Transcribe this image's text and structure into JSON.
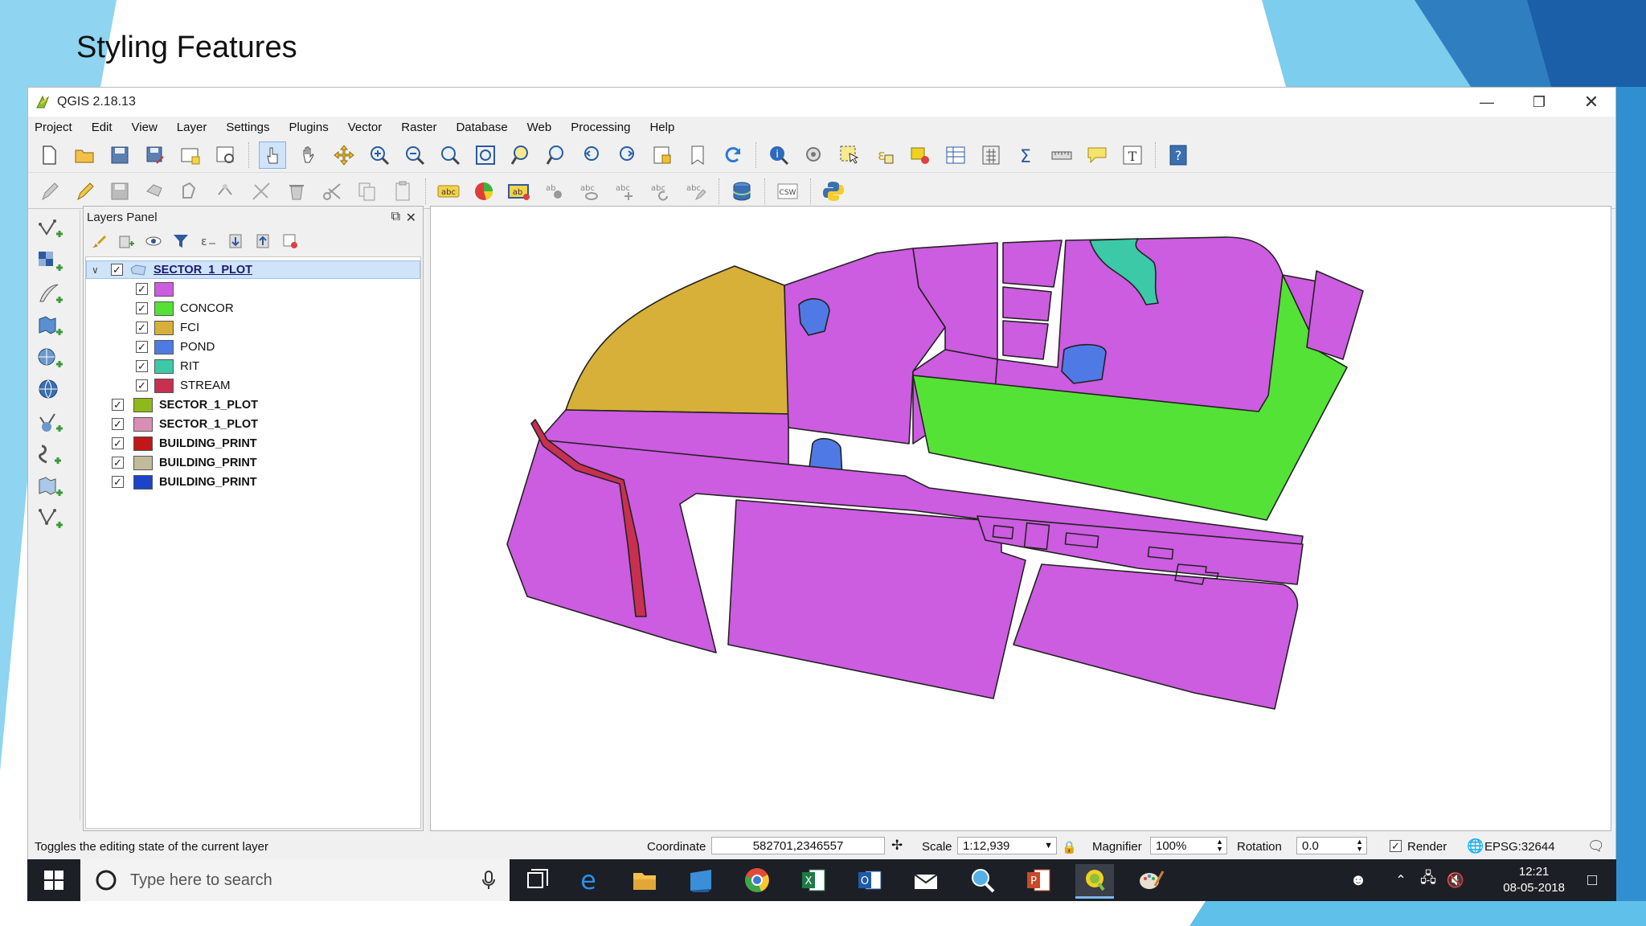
{
  "slide": {
    "title": "Styling Features"
  },
  "window": {
    "title": "QGIS 2.18.13"
  },
  "menu": [
    "Project",
    "Edit",
    "View",
    "Layer",
    "Settings",
    "Plugins",
    "Vector",
    "Raster",
    "Database",
    "Web",
    "Processing",
    "Help"
  ],
  "toolbar_icons": {
    "main": [
      "new-project-icon",
      "open-project-icon",
      "save-project-icon",
      "save-as-icon",
      "new-print-composer-icon",
      "composer-manager-icon",
      "touch-zoom-icon",
      "pan-icon",
      "pan-to-selection-icon",
      "zoom-in-icon",
      "zoom-out-icon",
      "zoom-native-icon",
      "zoom-full-icon",
      "zoom-to-selection-icon",
      "zoom-to-layer-icon",
      "zoom-last-icon",
      "zoom-next-icon",
      "new-map-view-icon",
      "new-bookmark-icon",
      "refresh-icon",
      "identify-icon",
      "action-icon",
      "select-feature-icon",
      "select-by-value-icon",
      "deselect-icon",
      "attribute-table-icon",
      "field-calculator-icon",
      "statistics-icon",
      "measure-icon",
      "map-tips-icon",
      "text-annotation-icon",
      "help-icon"
    ],
    "secondary": [
      "current-edits-icon",
      "toggle-editing-icon",
      "save-edits-icon",
      "add-feature-icon",
      "move-feature-icon",
      "node-tool-icon",
      "delete-selected-icon",
      "cut-features-icon",
      "copy-features-icon",
      "paste-features-icon",
      "label-icon",
      "diagram-icon",
      "layer-labeling-icon",
      "pin-labels-icon",
      "show-hide-labels-icon",
      "move-label-icon",
      "rotate-label-icon",
      "change-label-icon",
      "db-manager-icon",
      "csw-icon",
      "python-console-icon"
    ]
  },
  "toolbar_labels": {
    "abc": "abc",
    "csw": "CSW"
  },
  "side_toolbar_icons": [
    "add-vector-layer-icon",
    "add-raster-layer-icon",
    "add-delimited-text-icon",
    "add-spatialite-icon",
    "add-postgis-icon",
    "add-wms-icon",
    "add-wfs-icon",
    "add-virtual-layer-icon",
    "add-mssql-icon",
    "new-shapefile-icon"
  ],
  "layers_panel": {
    "title": "Layers Panel",
    "layers": [
      {
        "name": "SECTOR_1_PLOT",
        "level": 0,
        "checked": true,
        "selected": true,
        "expanded": true,
        "color": ""
      },
      {
        "name": "",
        "level": 1,
        "checked": true,
        "color": "#cc5ce0"
      },
      {
        "name": "CONCOR",
        "level": 1,
        "checked": true,
        "color": "#55e236"
      },
      {
        "name": "FCI",
        "level": 1,
        "checked": true,
        "color": "#d6b038"
      },
      {
        "name": "POND",
        "level": 1,
        "checked": true,
        "color": "#4f7ae6"
      },
      {
        "name": "RIT",
        "level": 1,
        "checked": true,
        "color": "#3cc9a8"
      },
      {
        "name": "STREAM",
        "level": 1,
        "checked": true,
        "color": "#c83050"
      },
      {
        "name": "SECTOR_1_PLOT",
        "level": 0,
        "checked": true,
        "color": "#8fb81a"
      },
      {
        "name": "SECTOR_1_PLOT",
        "level": 0,
        "checked": true,
        "color": "#d98fb4"
      },
      {
        "name": "BUILDING_PRINT",
        "level": 0,
        "checked": true,
        "color": "#c01818"
      },
      {
        "name": "BUILDING_PRINT",
        "level": 0,
        "checked": true,
        "color": "#c2bb9a"
      },
      {
        "name": "BUILDING_PRINT",
        "level": 0,
        "checked": true,
        "color": "#1c44c8"
      }
    ]
  },
  "map_colors": {
    "plot": "#cc5ce0",
    "concor": "#55e236",
    "fci": "#d6b038",
    "pond": "#4f7ae6",
    "rit": "#3cc9a8",
    "stream": "#c83050",
    "road": "#ffffff",
    "outline": "#222222"
  },
  "statusbar": {
    "message": "Toggles the editing state of the current layer",
    "coordinate_label": "Coordinate",
    "coordinate_value": "582701,2346557",
    "scale_label": "Scale",
    "scale_value": "1:12,939",
    "magnifier_label": "Magnifier",
    "magnifier_value": "100%",
    "rotation_label": "Rotation",
    "rotation_value": "0.0",
    "render_label": "Render",
    "render_checked": true,
    "crs": "EPSG:32644"
  },
  "taskbar": {
    "search_placeholder": "Type here to search",
    "apps": [
      "task-view-icon",
      "edge-icon",
      "file-explorer-icon",
      "store-icon",
      "chrome-icon",
      "excel-icon",
      "outlook-icon",
      "mail-icon",
      "magnifier-app-icon",
      "powerpoint-icon",
      "qgis-icon",
      "paint-icon"
    ],
    "time": "12:21",
    "date": "08-05-2018"
  }
}
